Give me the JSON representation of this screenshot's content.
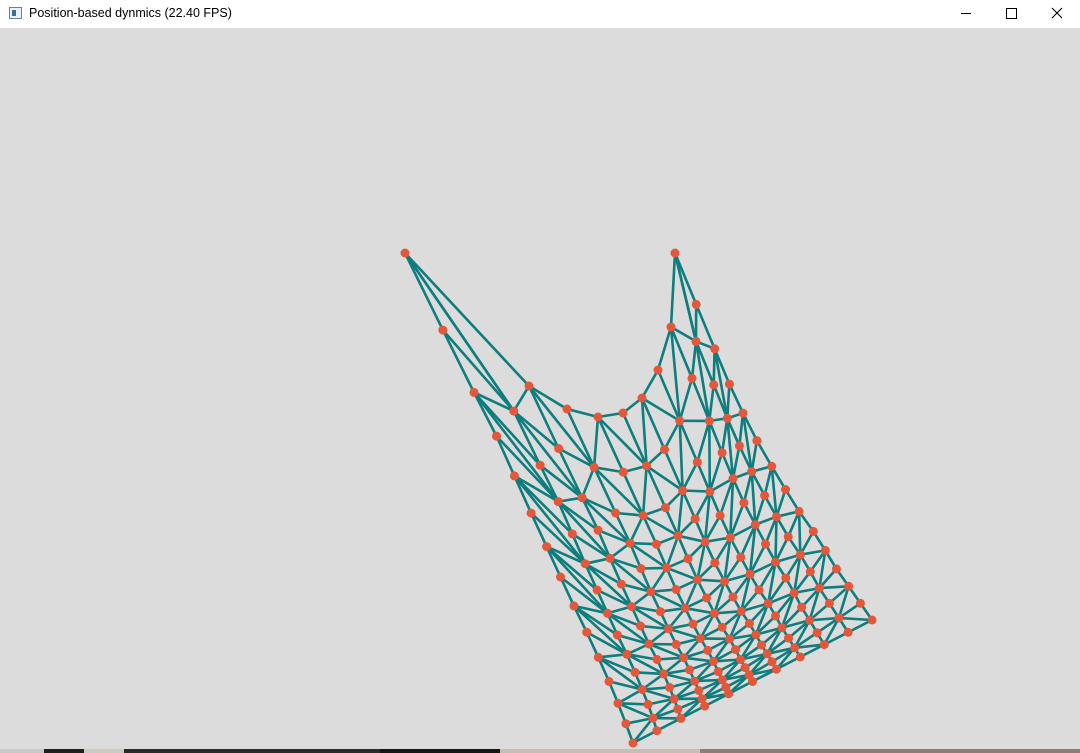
{
  "window": {
    "title": "Position-based dynmics (22.40 FPS)",
    "icons": {
      "app": "app-window-icon",
      "minimize": "minimize-icon",
      "maximize": "maximize-icon",
      "close": "close-icon"
    }
  },
  "scene": {
    "background_color": "#dcdcdc",
    "edge_color": "#0e7d7d",
    "particle_color": "#e3573a",
    "cloth_grid": {
      "columns": 11,
      "rows": 15
    }
  }
}
